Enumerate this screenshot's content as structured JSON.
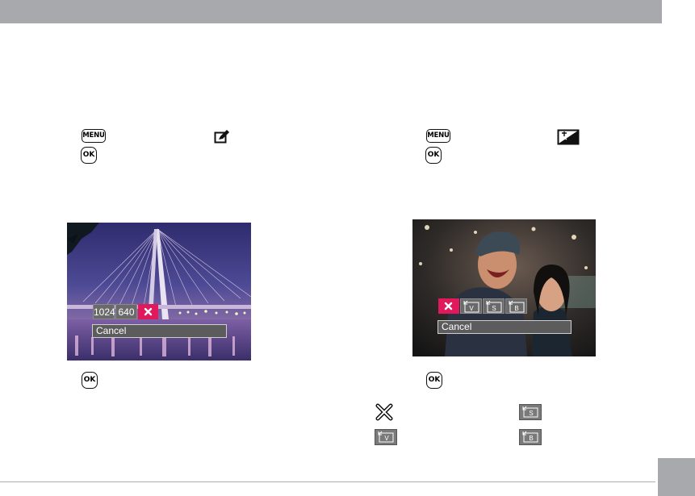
{
  "controls": {
    "menu_label": "MENU",
    "ok_label": "OK"
  },
  "left_panel": {
    "options": [
      "1024",
      "640"
    ],
    "cancel_label": "Cancel"
  },
  "right_panel": {
    "cancel_label": "Cancel"
  },
  "icons": {
    "left_mode": "resize-edit-icon",
    "right_mode": "color-enhance-icon",
    "cancel": "x-icon",
    "sizes": [
      "resize-v-icon",
      "resize-s-icon",
      "resize-b-icon"
    ]
  },
  "colors": {
    "header": "#a7a9ac",
    "selected": "#e2185c",
    "option": "#6a6a6a"
  }
}
